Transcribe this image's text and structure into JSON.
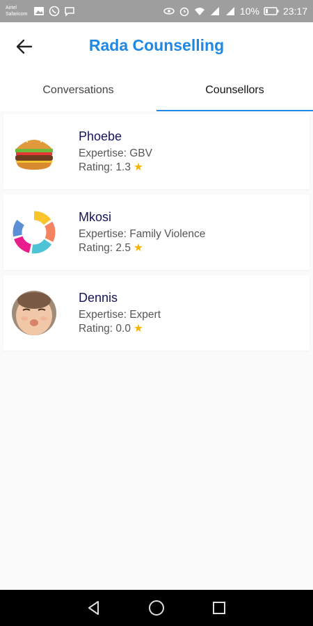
{
  "status_bar": {
    "carrier_line1": "Airtel",
    "carrier_line2": "Safaricom",
    "battery_percent": "10%",
    "time": "23:17"
  },
  "app_bar": {
    "title": "Rada Counselling"
  },
  "tabs": [
    {
      "label": "Conversations",
      "active": false
    },
    {
      "label": "Counsellors",
      "active": true
    }
  ],
  "counsellors": [
    {
      "name": "Phoebe",
      "expertise": "Expertise: GBV",
      "rating": "Rating: 1.3",
      "avatar": "burger-image"
    },
    {
      "name": "Mkosi",
      "expertise": "Expertise: Family Violence",
      "rating": "Rating: 2.5",
      "avatar": "color-ring-image"
    },
    {
      "name": "Dennis",
      "expertise": "Expertise: Expert",
      "rating": "Rating: 0.0",
      "avatar": "face-photo"
    }
  ],
  "colors": {
    "accent": "#1e88e5",
    "star": "#f5b400",
    "name_text": "#14145a"
  }
}
